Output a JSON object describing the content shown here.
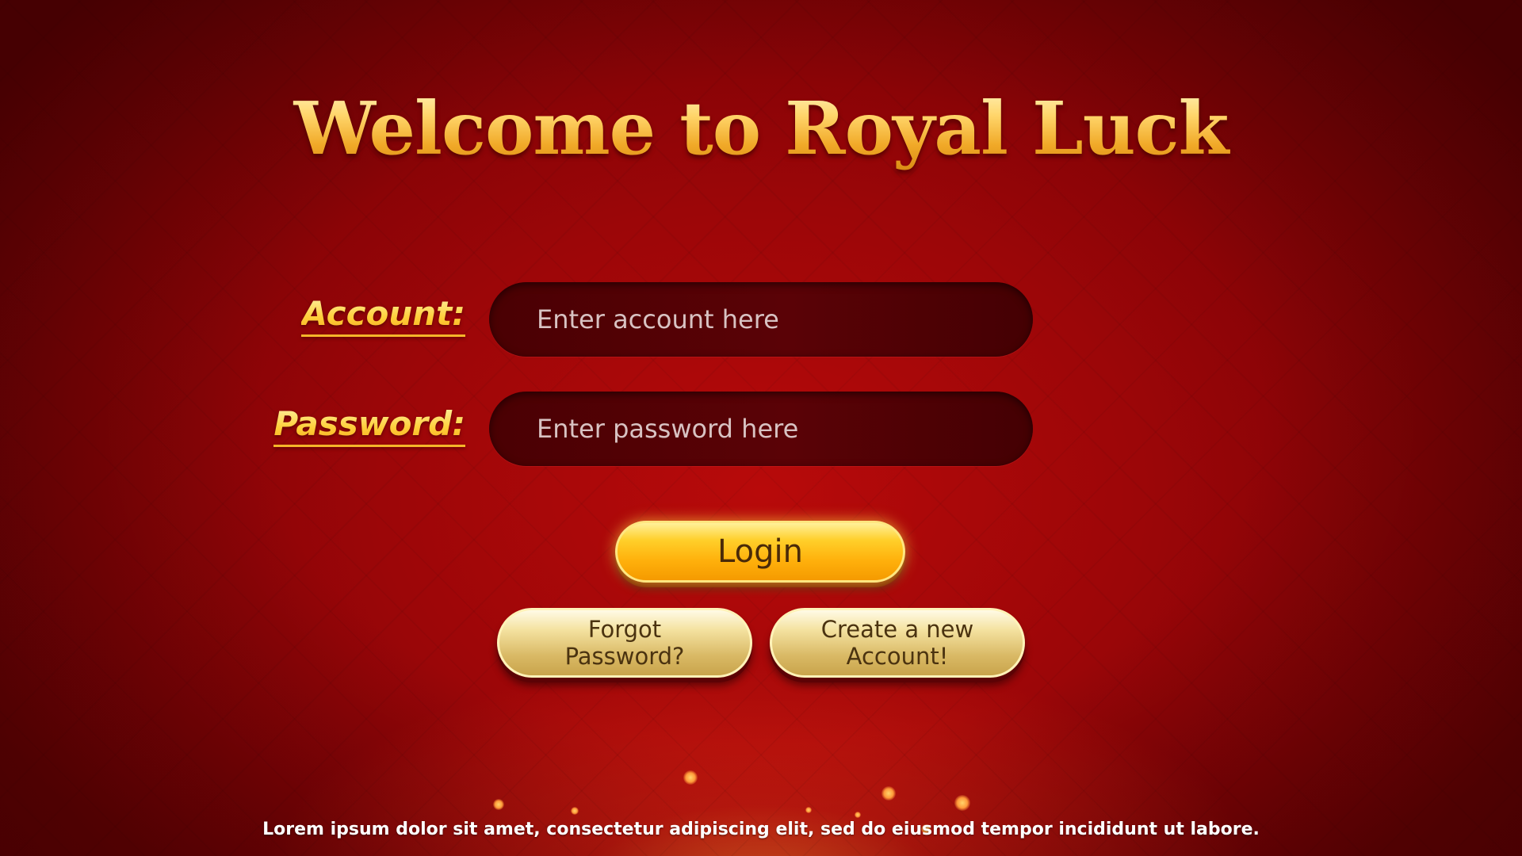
{
  "title": "Welcome to Royal Luck",
  "form": {
    "account_label": "Account:",
    "account_placeholder": "Enter account here",
    "password_label": "Password:",
    "password_placeholder": "Enter password here"
  },
  "buttons": {
    "login": "Login",
    "forgot_line1": "Forgot",
    "forgot_line2": "Password?",
    "create_line1": "Create a new",
    "create_line2": "Account!"
  },
  "footer": {
    "text": "Lorem ipsum dolor sit amet, consectetur adipiscing elit, sed do eiusmod tempor incididunt ut labore."
  },
  "colors": {
    "background": "#9c0608",
    "title_gold": "#f6c452",
    "label_gold": "#ffd042",
    "input_bg": "#4a0003",
    "login_button": "#ffb10c",
    "secondary_button": "#d9b965"
  }
}
